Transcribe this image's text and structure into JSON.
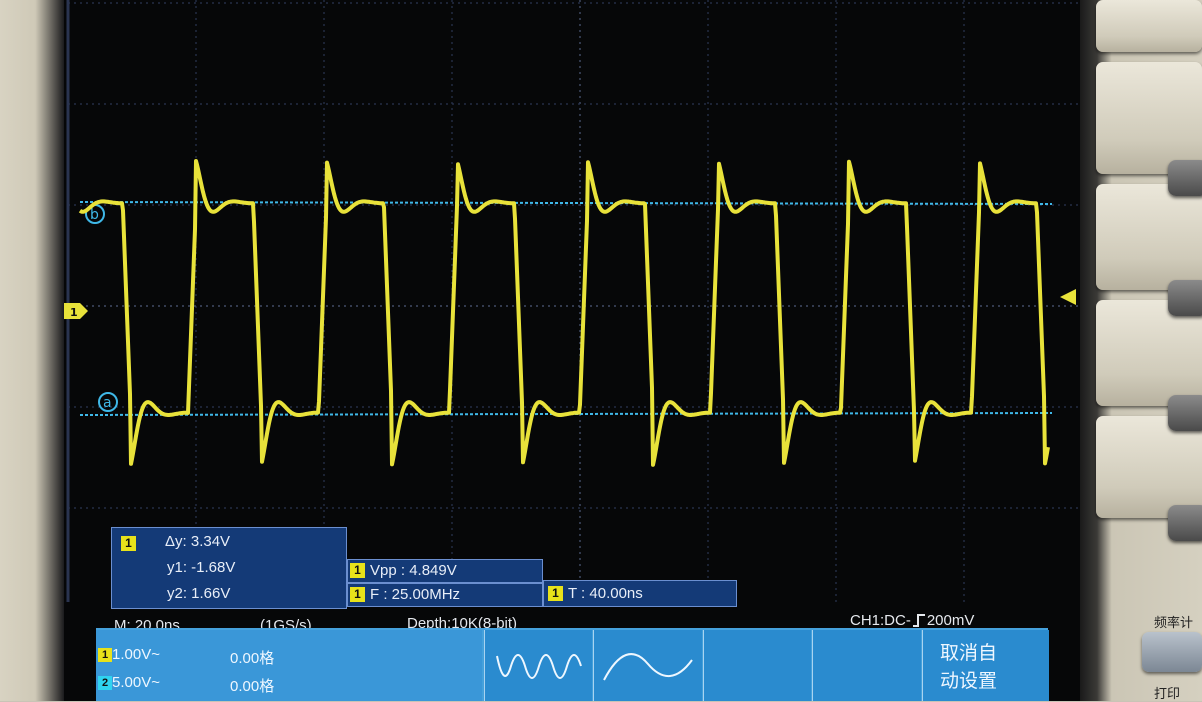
{
  "screen": {
    "timebase": "M: 20.0ns",
    "sample_rate": "(1GS/s)",
    "depth": "Depth:10K(8-bit)",
    "trigger": "CH1:DC- ⅀ 200mV",
    "trigger_parts": {
      "prefix": "CH1:DC-",
      "edge_icon": "rising-edge-icon",
      "level": "200mV"
    }
  },
  "cursor_measure": {
    "channel": "1",
    "dy": "Δy: 3.34V",
    "y1": "y1: -1.68V",
    "y2": "y2: 1.66V",
    "cursor_a_label": "a",
    "cursor_b_label": "b"
  },
  "measurements": {
    "vpp": {
      "channel": "1",
      "text": "Vpp : 4.849V"
    },
    "freq": {
      "channel": "1",
      "text": "F : 25.00MHz"
    },
    "period": {
      "channel": "1",
      "text": "T : 40.00ns"
    }
  },
  "channel_marker": "1",
  "bottom_menu": {
    "ch1": {
      "num": "1",
      "scale": "1.00V~",
      "offset": "0.00格"
    },
    "ch2": {
      "num": "2",
      "scale": "5.00V~",
      "offset": "0.00格"
    },
    "btn_auto_cancel": [
      "取消自",
      "动设置"
    ],
    "icons": [
      "multi-period-wave-icon",
      "single-period-wave-icon"
    ]
  },
  "hardware": {
    "label_freq": "频率计",
    "label_print": "打印"
  },
  "colors": {
    "ch1_trace": "#e8e23a",
    "cursor_line": "#3fb8e8",
    "menu_bg": "#2a8bcf",
    "measure_bg": "#143a77"
  },
  "chart_data": {
    "type": "line",
    "series": [
      {
        "name": "1",
        "values": []
      }
    ],
    "x_unit": "ns",
    "y_unit": "V",
    "period_ns": 40.0,
    "frequency_mhz": 25.0,
    "vpp_v": 4.849,
    "cursor_y1_v": -1.68,
    "cursor_y2_v": 1.66,
    "delta_y_v": 3.34
  }
}
